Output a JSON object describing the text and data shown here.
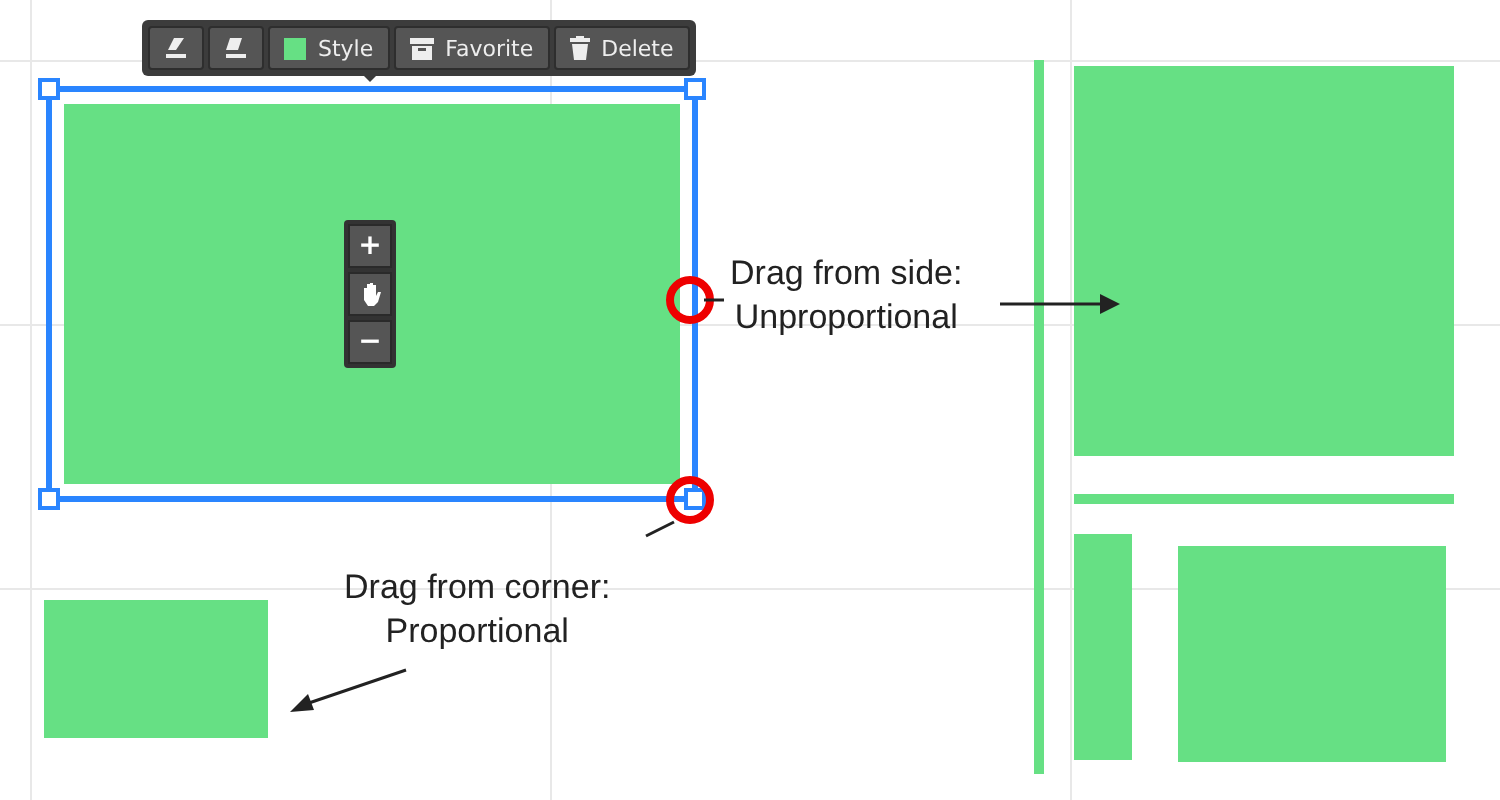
{
  "toolbar": {
    "buttons": [
      {
        "kind": "icon"
      },
      {
        "kind": "icon"
      },
      {
        "kind": "swatch",
        "label": "Style",
        "color": "#66e084"
      },
      {
        "kind": "favorite",
        "label": "Favorite"
      },
      {
        "kind": "delete",
        "label": "Delete"
      }
    ]
  },
  "zoom_controls": {
    "zoom_in": "+",
    "zoom_out": "−"
  },
  "shapes": [
    {
      "selected": true
    },
    {
      "selected": false
    },
    {
      "selected": false
    },
    {
      "selected": false
    },
    {
      "selected": false
    },
    {
      "selected": false
    },
    {
      "selected": false
    }
  ],
  "annotations": [
    {
      "text": "Drag from side:\nUnproportional"
    },
    {
      "text": "Drag from corner:\nProportional"
    }
  ]
}
